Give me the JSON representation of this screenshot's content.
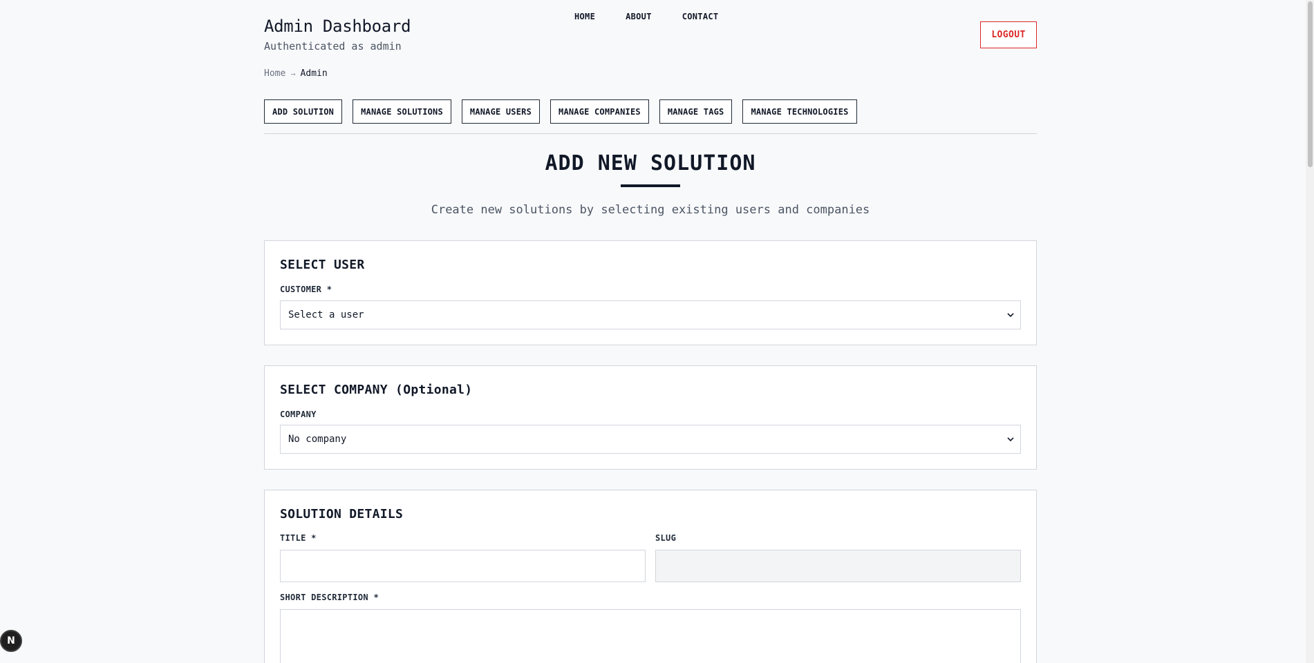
{
  "header": {
    "title": "Admin Dashboard",
    "subtitle": "Authenticated as admin"
  },
  "topnav": {
    "home": "HOME",
    "about": "ABOUT",
    "contact": "CONTACT"
  },
  "logout_label": "LOGOUT",
  "breadcrumb": {
    "home": "Home",
    "separator": "→",
    "current": "Admin"
  },
  "admin_nav": [
    "ADD SOLUTION",
    "MANAGE SOLUTIONS",
    "MANAGE USERS",
    "MANAGE COMPANIES",
    "MANAGE TAGS",
    "MANAGE TECHNOLOGIES"
  ],
  "page": {
    "title": "ADD NEW SOLUTION",
    "description": "Create new solutions by selecting existing users and companies"
  },
  "select_user": {
    "title": "SELECT USER",
    "label": "CUSTOMER *",
    "value": "Select a user"
  },
  "select_company": {
    "title": "SELECT COMPANY (Optional)",
    "label": "COMPANY",
    "value": "No company"
  },
  "solution_details": {
    "title": "SOLUTION DETAILS",
    "title_label": "TITLE *",
    "slug_label": "SLUG",
    "short_description_label": "SHORT DESCRIPTION *"
  },
  "badge": "N",
  "colors": {
    "danger": "#dc2626",
    "text": "#111827",
    "border": "#d1d5db",
    "background": "#f8f9fb"
  }
}
